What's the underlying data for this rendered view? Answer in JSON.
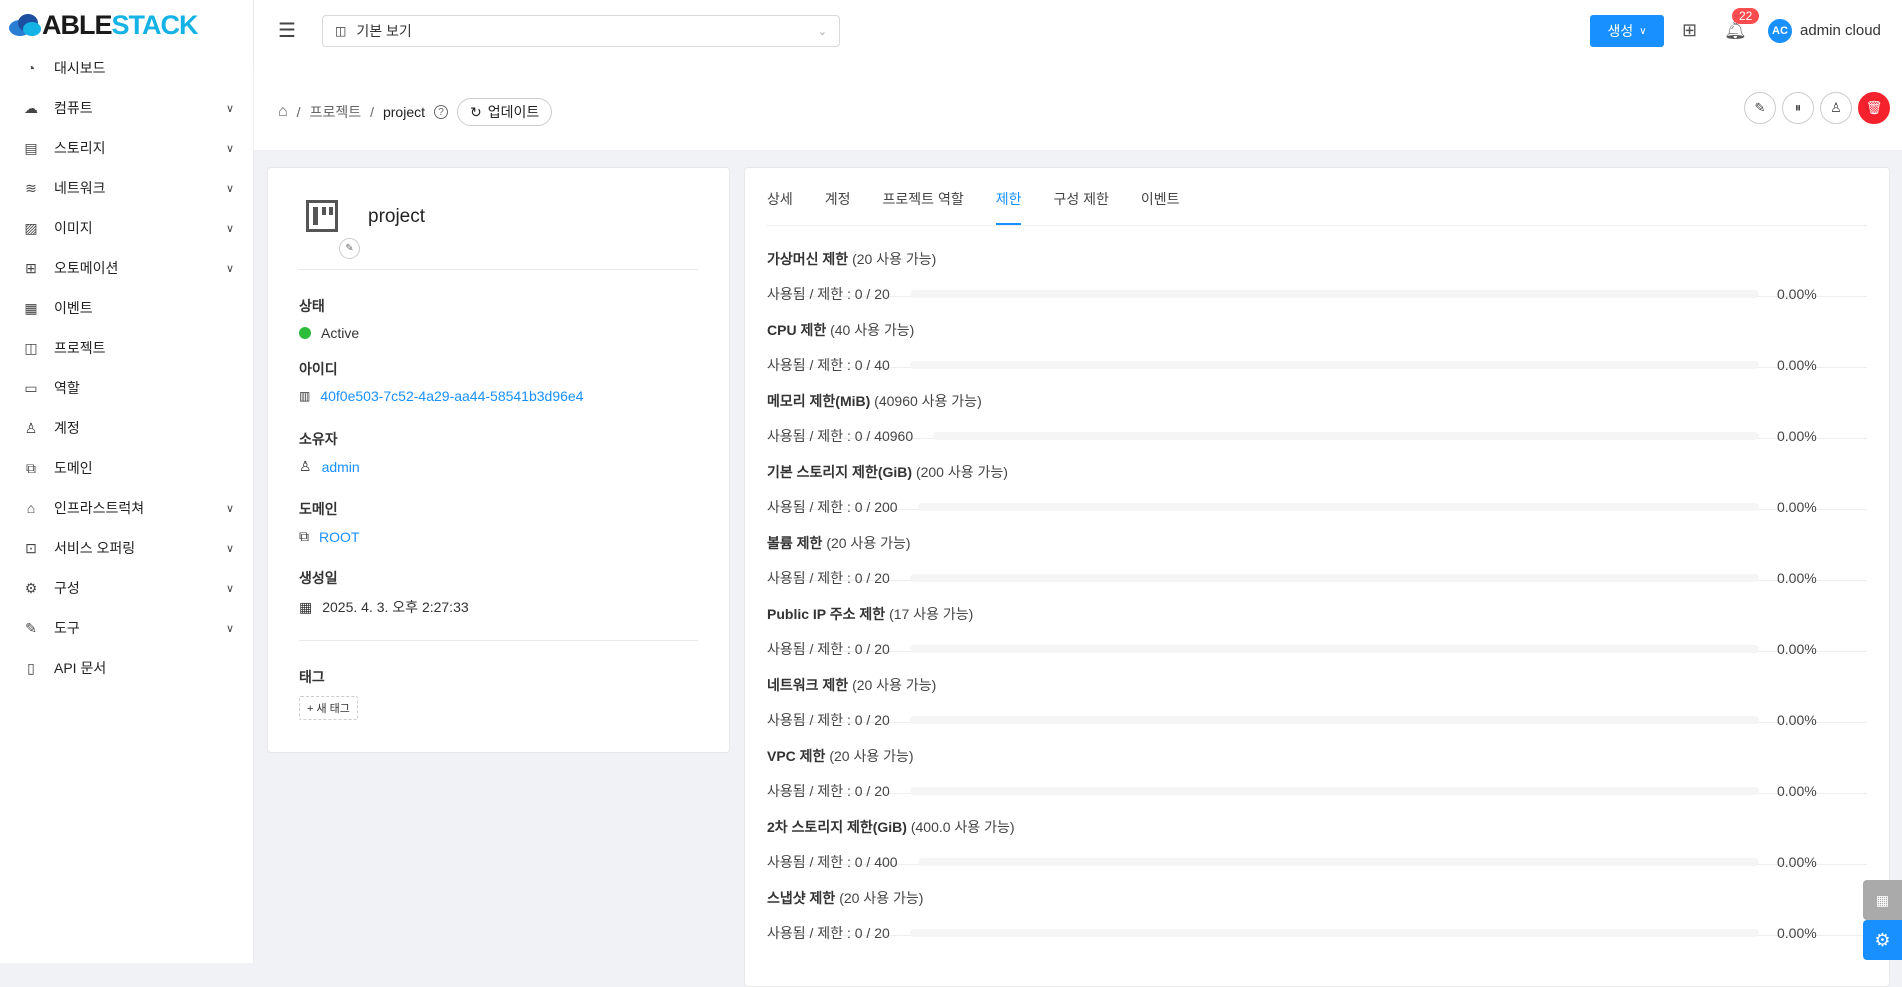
{
  "brand": {
    "part1": "ABLE",
    "part2": "STACK"
  },
  "sidebar": {
    "items": [
      {
        "label": "대시보드",
        "icon": "dashboard-icon",
        "chev": false,
        "g": "◔"
      },
      {
        "label": "컴퓨트",
        "icon": "cloud-icon",
        "chev": true,
        "g": "☁"
      },
      {
        "label": "스토리지",
        "icon": "storage-icon",
        "chev": true,
        "g": "▤"
      },
      {
        "label": "네트워크",
        "icon": "wifi-icon",
        "chev": true,
        "g": "≋"
      },
      {
        "label": "이미지",
        "icon": "image-icon",
        "chev": true,
        "g": "▨"
      },
      {
        "label": "오토메이션",
        "icon": "automation-icon",
        "chev": true,
        "g": "⊞"
      },
      {
        "label": "이벤트",
        "icon": "calendar-icon",
        "chev": false,
        "g": "▦"
      },
      {
        "label": "프로젝트",
        "icon": "project-icon",
        "chev": false,
        "g": "◫"
      },
      {
        "label": "역할",
        "icon": "id-card-icon",
        "chev": false,
        "g": "▭"
      },
      {
        "label": "계정",
        "icon": "user-icon",
        "chev": false,
        "g": "♙"
      },
      {
        "label": "도메인",
        "icon": "block-icon",
        "chev": false,
        "g": "⧉"
      },
      {
        "label": "인프라스트럭쳐",
        "icon": "bank-icon",
        "chev": true,
        "g": "⌂"
      },
      {
        "label": "서비스 오퍼링",
        "icon": "shopping-icon",
        "chev": true,
        "g": "⊡"
      },
      {
        "label": "구성",
        "icon": "setting-icon",
        "chev": true,
        "g": "⚙"
      },
      {
        "label": "도구",
        "icon": "tool-icon",
        "chev": true,
        "g": "✎"
      },
      {
        "label": "API 문서",
        "icon": "book-icon",
        "chev": false,
        "g": "▯"
      }
    ]
  },
  "header": {
    "search_value": "기본 보기",
    "create_label": "생성",
    "notification_count": "22",
    "avatar_initials": "AC",
    "username": "admin cloud"
  },
  "breadcrumb": {
    "items": [
      "프로젝트",
      "project"
    ],
    "update_label": "업데이트"
  },
  "project": {
    "name": "project",
    "fields": {
      "status_label": "상태",
      "status": "Active",
      "id_label": "아이디",
      "id": "40f0e503-7c52-4a29-aa44-58541b3d96e4",
      "owner_label": "소유자",
      "owner": "admin",
      "domain_label": "도메인",
      "domain": "ROOT",
      "created_label": "생성일",
      "created": "2025. 4. 3. 오후 2:27:33",
      "tags_label": "태그",
      "new_tag": "+ 새 태그"
    },
    "status_color": "#2ebd3b"
  },
  "tabs": [
    {
      "label": "상세"
    },
    {
      "label": "계정"
    },
    {
      "label": "프로젝트 역할"
    },
    {
      "label": "제한",
      "active": true
    },
    {
      "label": "구성 제한"
    },
    {
      "label": "이벤트"
    }
  ],
  "quotas": [
    {
      "name": "가상머신 제한",
      "avail": "(20 사용 가능)",
      "usage": "사용됨 / 제한 : 0 / 20",
      "percent": 0,
      "percent_label": "0.00%"
    },
    {
      "name": "CPU 제한",
      "avail": "(40 사용 가능)",
      "usage": "사용됨 / 제한 : 0 / 40",
      "percent": 0,
      "percent_label": "0.00%"
    },
    {
      "name": "메모리 제한(MiB)",
      "avail": "(40960 사용 가능)",
      "usage": "사용됨 / 제한 : 0 / 40960",
      "percent": 0,
      "percent_label": "0.00%"
    },
    {
      "name": "기본 스토리지 제한(GiB)",
      "avail": "(200 사용 가능)",
      "usage": "사용됨 / 제한 : 0 / 200",
      "percent": 0,
      "percent_label": "0.00%"
    },
    {
      "name": "볼륨 제한",
      "avail": "(20 사용 가능)",
      "usage": "사용됨 / 제한 : 0 / 20",
      "percent": 0,
      "percent_label": "0.00%"
    },
    {
      "name": "Public IP 주소 제한",
      "avail": "(17 사용 가능)",
      "usage": "사용됨 / 제한 : 0 / 20",
      "percent": 0,
      "percent_label": "0.00%"
    },
    {
      "name": "네트워크 제한",
      "avail": "(20 사용 가능)",
      "usage": "사용됨 / 제한 : 0 / 20",
      "percent": 0,
      "percent_label": "0.00%"
    },
    {
      "name": "VPC 제한",
      "avail": "(20 사용 가능)",
      "usage": "사용됨 / 제한 : 0 / 20",
      "percent": 0,
      "percent_label": "0.00%"
    },
    {
      "name": "2차 스토리지 제한(GiB)",
      "avail": "(400.0 사용 가능)",
      "usage": "사용됨 / 제한 : 0 / 400",
      "percent": 0,
      "percent_label": "0.00%"
    },
    {
      "name": "스냅샷 제한",
      "avail": "(20 사용 가능)",
      "usage": "사용됨 / 제한 : 0 / 20",
      "percent": 0,
      "percent_label": "0.00%"
    }
  ],
  "colors": {
    "primary": "#1890ff",
    "danger": "#f5222d",
    "badge": "#ff4d4f"
  }
}
